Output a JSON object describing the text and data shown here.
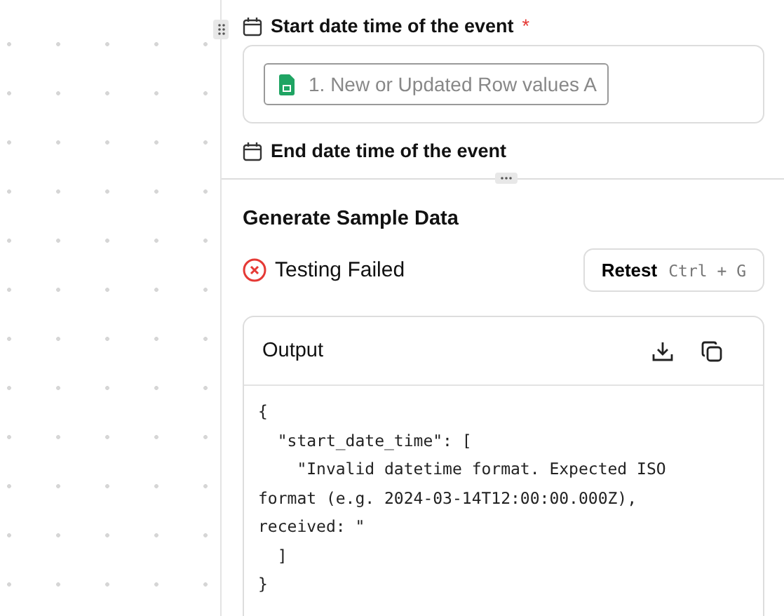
{
  "fields": [
    {
      "label": "Start date time of the event",
      "required_mark": "*",
      "value": "1. New or Updated Row values A"
    },
    {
      "label": "End date time of the event"
    }
  ],
  "sample": {
    "title": "Generate Sample Data",
    "status": {
      "kind": "failed",
      "text": "Testing Failed"
    },
    "retest": {
      "label": "Retest",
      "shortcut": "Ctrl + G"
    },
    "output": {
      "title": "Output",
      "lines": [
        "{",
        "  \"start_date_time\": [",
        "    \"Invalid datetime format. Expected ISO",
        "format (e.g. 2024-03-14T12:00:00.000Z),",
        "received: \"",
        "  ]",
        "}"
      ]
    }
  }
}
